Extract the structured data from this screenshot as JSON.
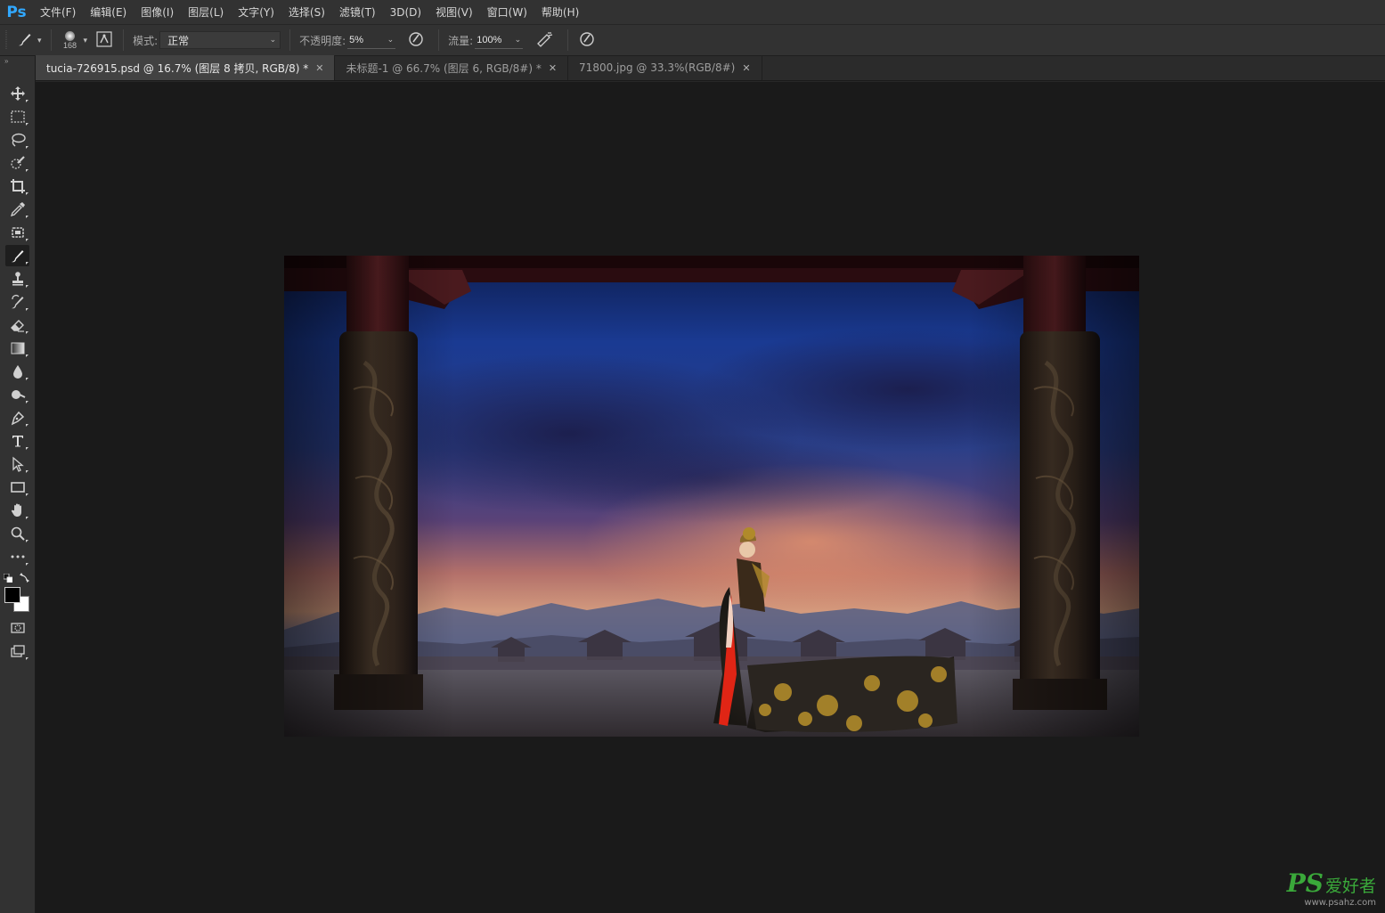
{
  "app": {
    "logo": "Ps"
  },
  "menu": [
    "文件(F)",
    "编辑(E)",
    "图像(I)",
    "图层(L)",
    "文字(Y)",
    "选择(S)",
    "滤镜(T)",
    "3D(D)",
    "视图(V)",
    "窗口(W)",
    "帮助(H)"
  ],
  "options": {
    "brush_size": "168",
    "mode_label": "模式:",
    "mode_value": "正常",
    "opacity_label": "不透明度:",
    "opacity_value": "5%",
    "flow_label": "流量:",
    "flow_value": "100%"
  },
  "tabs": [
    {
      "title": "tucia-726915.psd @ 16.7% (图层 8 拷贝, RGB/8) *",
      "active": true
    },
    {
      "title": "未标题-1 @ 66.7% (图层 6, RGB/8#) *",
      "active": false
    },
    {
      "title": "71800.jpg @ 33.3%(RGB/8#)",
      "active": false
    }
  ],
  "tools": [
    "move-tool",
    "marquee-tool",
    "lasso-tool",
    "quick-selection-tool",
    "crop-tool",
    "eyedropper-tool",
    "patch-tool",
    "brush-tool",
    "clone-stamp-tool",
    "history-brush-tool",
    "eraser-tool",
    "gradient-tool",
    "blur-tool",
    "dodge-tool",
    "pen-tool",
    "type-tool",
    "path-selection-tool",
    "rectangle-tool",
    "hand-tool",
    "zoom-tool",
    "more-tools"
  ],
  "active_tool": "brush-tool",
  "colors": {
    "foreground": "#000000",
    "background": "#ffffff",
    "accent": "#31a8ff"
  },
  "watermark": {
    "logo": "PS",
    "logo_cn": "爱好者",
    "url": "www.psahz.com"
  }
}
